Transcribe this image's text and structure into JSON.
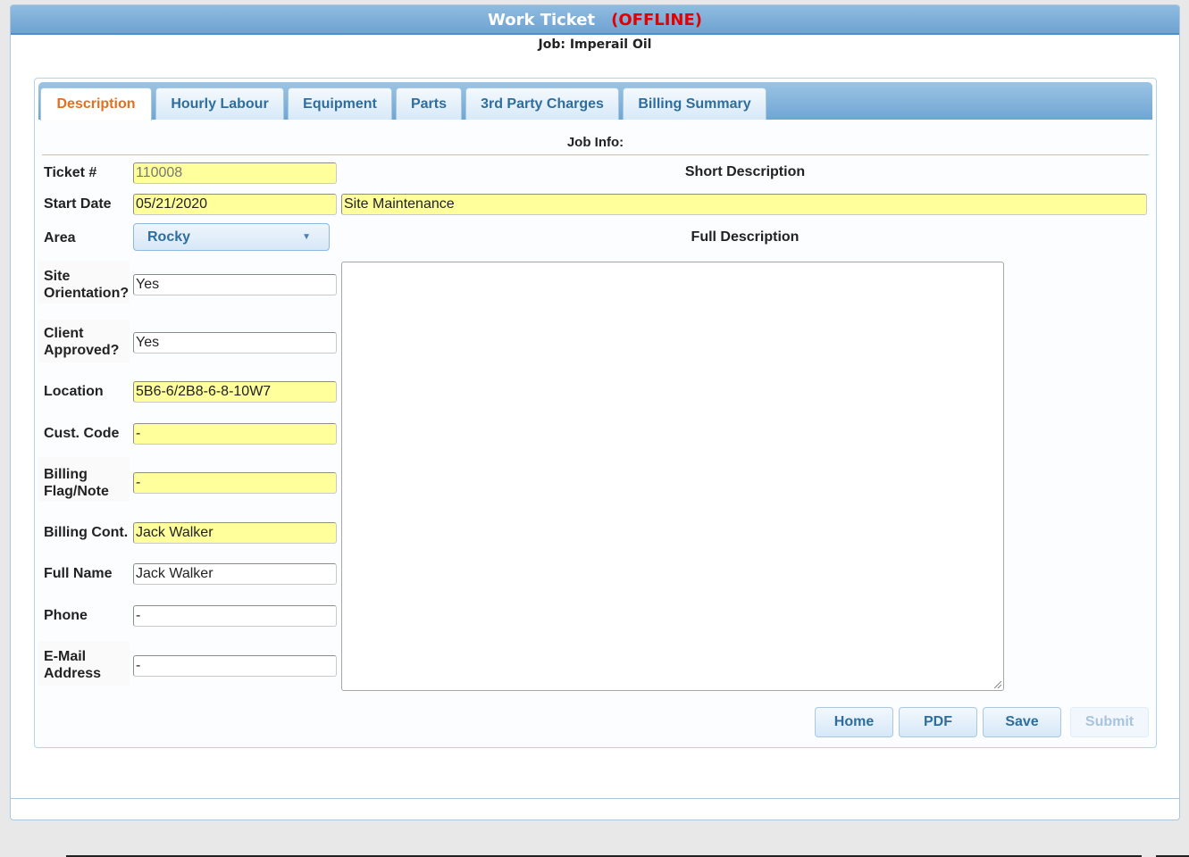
{
  "window": {
    "title": "Work Ticket",
    "status": "(OFFLINE)",
    "job_line": "Job: Imperail Oil"
  },
  "tabs": [
    {
      "label": "Description",
      "active": true
    },
    {
      "label": "Hourly Labour",
      "active": false
    },
    {
      "label": "Equipment",
      "active": false
    },
    {
      "label": "Parts",
      "active": false
    },
    {
      "label": "3rd Party Charges",
      "active": false
    },
    {
      "label": "Billing Summary",
      "active": false
    }
  ],
  "section_title": "Job Info:",
  "fields": {
    "ticket": {
      "label": "Ticket #",
      "value": "110008"
    },
    "start_date": {
      "label": "Start Date",
      "value": "05/21/2020"
    },
    "area": {
      "label": "Area",
      "value": "Rocky"
    },
    "site_orientation": {
      "label": "Site Orientation?",
      "value": "Yes"
    },
    "client_approved": {
      "label": "Client Approved?",
      "value": "Yes"
    },
    "location": {
      "label": "Location",
      "value": "5B6-6/2B8-6-8-10W7"
    },
    "cust_code": {
      "label": "Cust. Code",
      "value": "-"
    },
    "billing_flag": {
      "label": "Billing Flag/Note",
      "value": "-"
    },
    "billing_cont": {
      "label": "Billing Cont.",
      "value": "Jack Walker"
    },
    "full_name": {
      "label": "Full Name",
      "value": "Jack Walker"
    },
    "phone": {
      "label": "Phone",
      "value": "-"
    },
    "email": {
      "label": "E-Mail Address",
      "value": "-"
    }
  },
  "short_description": {
    "label": "Short Description",
    "value": "Site Maintenance"
  },
  "full_description": {
    "label": "Full Description",
    "value": ""
  },
  "buttons": {
    "home": "Home",
    "pdf": "PDF",
    "save": "Save",
    "submit": "Submit"
  },
  "colors": {
    "header_blue": "#6fa3d2",
    "offline_red": "#e30000",
    "active_tab_orange": "#e1701f",
    "required_yellow": "#ffff9c",
    "button_text_blue": "#2e6e9e"
  }
}
